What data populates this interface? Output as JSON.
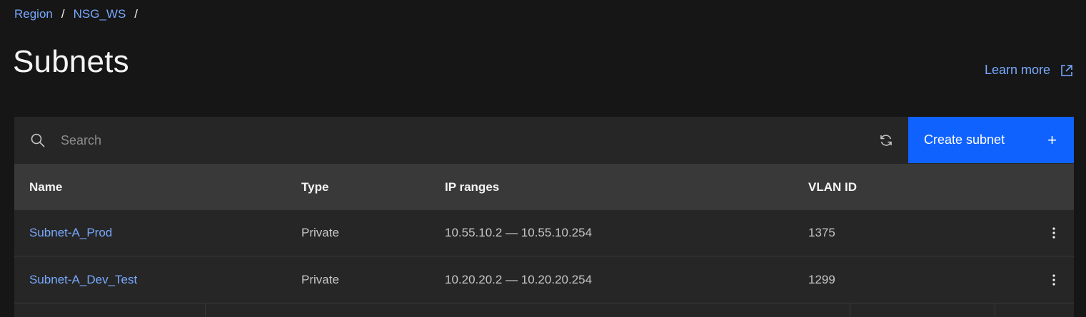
{
  "breadcrumb": {
    "items": [
      "Region",
      "NSG_WS"
    ],
    "separator": "/"
  },
  "page": {
    "title": "Subnets",
    "learn_more": "Learn more"
  },
  "toolbar": {
    "search_placeholder": "Search",
    "search_value": "",
    "create_label": "Create subnet",
    "create_icon": "plus-icon",
    "refresh_icon": "refresh-icon"
  },
  "table": {
    "headers": {
      "name": "Name",
      "type": "Type",
      "ip_ranges": "IP ranges",
      "vlan_id": "VLAN ID"
    },
    "rows": [
      {
        "name": "Subnet-A_Prod",
        "type": "Private",
        "ip_ranges": "10.55.10.2 — 10.55.10.254",
        "vlan_id": "1375"
      },
      {
        "name": "Subnet-A_Dev_Test",
        "type": "Private",
        "ip_ranges": "10.20.20.2 — 10.20.20.254",
        "vlan_id": "1299"
      }
    ]
  },
  "colors": {
    "background": "#161616",
    "surface": "#262626",
    "header": "#393939",
    "link": "#78a9ff",
    "primary": "#0f62fe"
  }
}
